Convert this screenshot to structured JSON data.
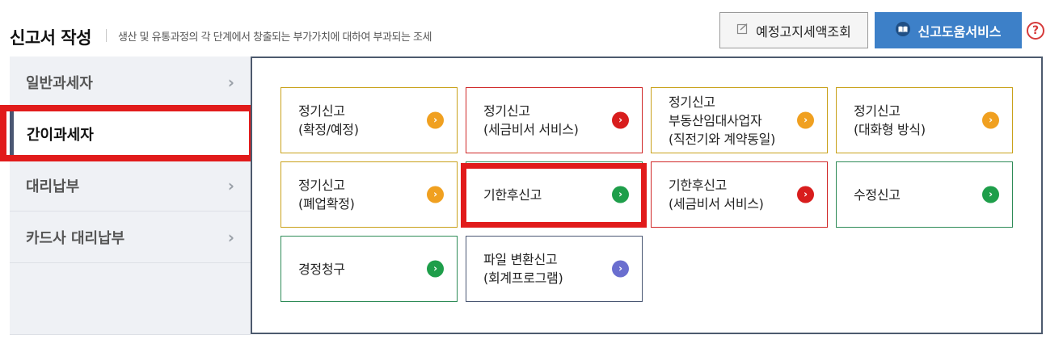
{
  "header": {
    "title": "신고서 작성",
    "description": "생산 및 유통과정의 각 단계에서 창출되는 부가가치에 대하여 부과되는 조세",
    "lookup_button": "예정고지세액조회",
    "help_service_button": "신고도움서비스",
    "help_icon": "?"
  },
  "sidebar": {
    "items": [
      {
        "label": "일반과세자",
        "active": false
      },
      {
        "label": "간이과세자",
        "active": true
      },
      {
        "label": "대리납부",
        "active": false
      },
      {
        "label": "카드사 대리납부",
        "active": false
      }
    ],
    "chevron": "›"
  },
  "cards": [
    {
      "label": "정기신고\n(확정/예정)",
      "accent": "#c9a11a",
      "arrow_color": "#f0a020"
    },
    {
      "label": "정기신고\n(세금비서 서비스)",
      "accent": "#d02828",
      "arrow_color": "#d81d1d"
    },
    {
      "label": "정기신고\n부동산임대사업자\n(직전기와 계약동일)",
      "accent": "#c9a11a",
      "arrow_color": "#f0a020"
    },
    {
      "label": "정기신고\n(대화형 방식)",
      "accent": "#c9a11a",
      "arrow_color": "#f0a020"
    },
    {
      "label": "정기신고\n(폐업확정)",
      "accent": "#c9a11a",
      "arrow_color": "#f0a020"
    },
    {
      "label": "기한후신고",
      "accent": "#2e8b57",
      "arrow_color": "#1e9e4a"
    },
    {
      "label": "기한후신고\n(세금비서 서비스)",
      "accent": "#d02828",
      "arrow_color": "#d81d1d"
    },
    {
      "label": "수정신고",
      "accent": "#2e8b57",
      "arrow_color": "#1e9e4a"
    },
    {
      "label": "경정청구",
      "accent": "#2e8b57",
      "arrow_color": "#1e9e4a"
    },
    {
      "label": "파일 변환신고\n(회계프로그램)",
      "accent": "#4a5773",
      "arrow_color": "#6a6ecf"
    }
  ],
  "arrow_glyph": "›",
  "colors": {
    "highlight": "#e11b1b",
    "primary_button": "#3d80c8",
    "panel_border": "#4d5a6e"
  }
}
